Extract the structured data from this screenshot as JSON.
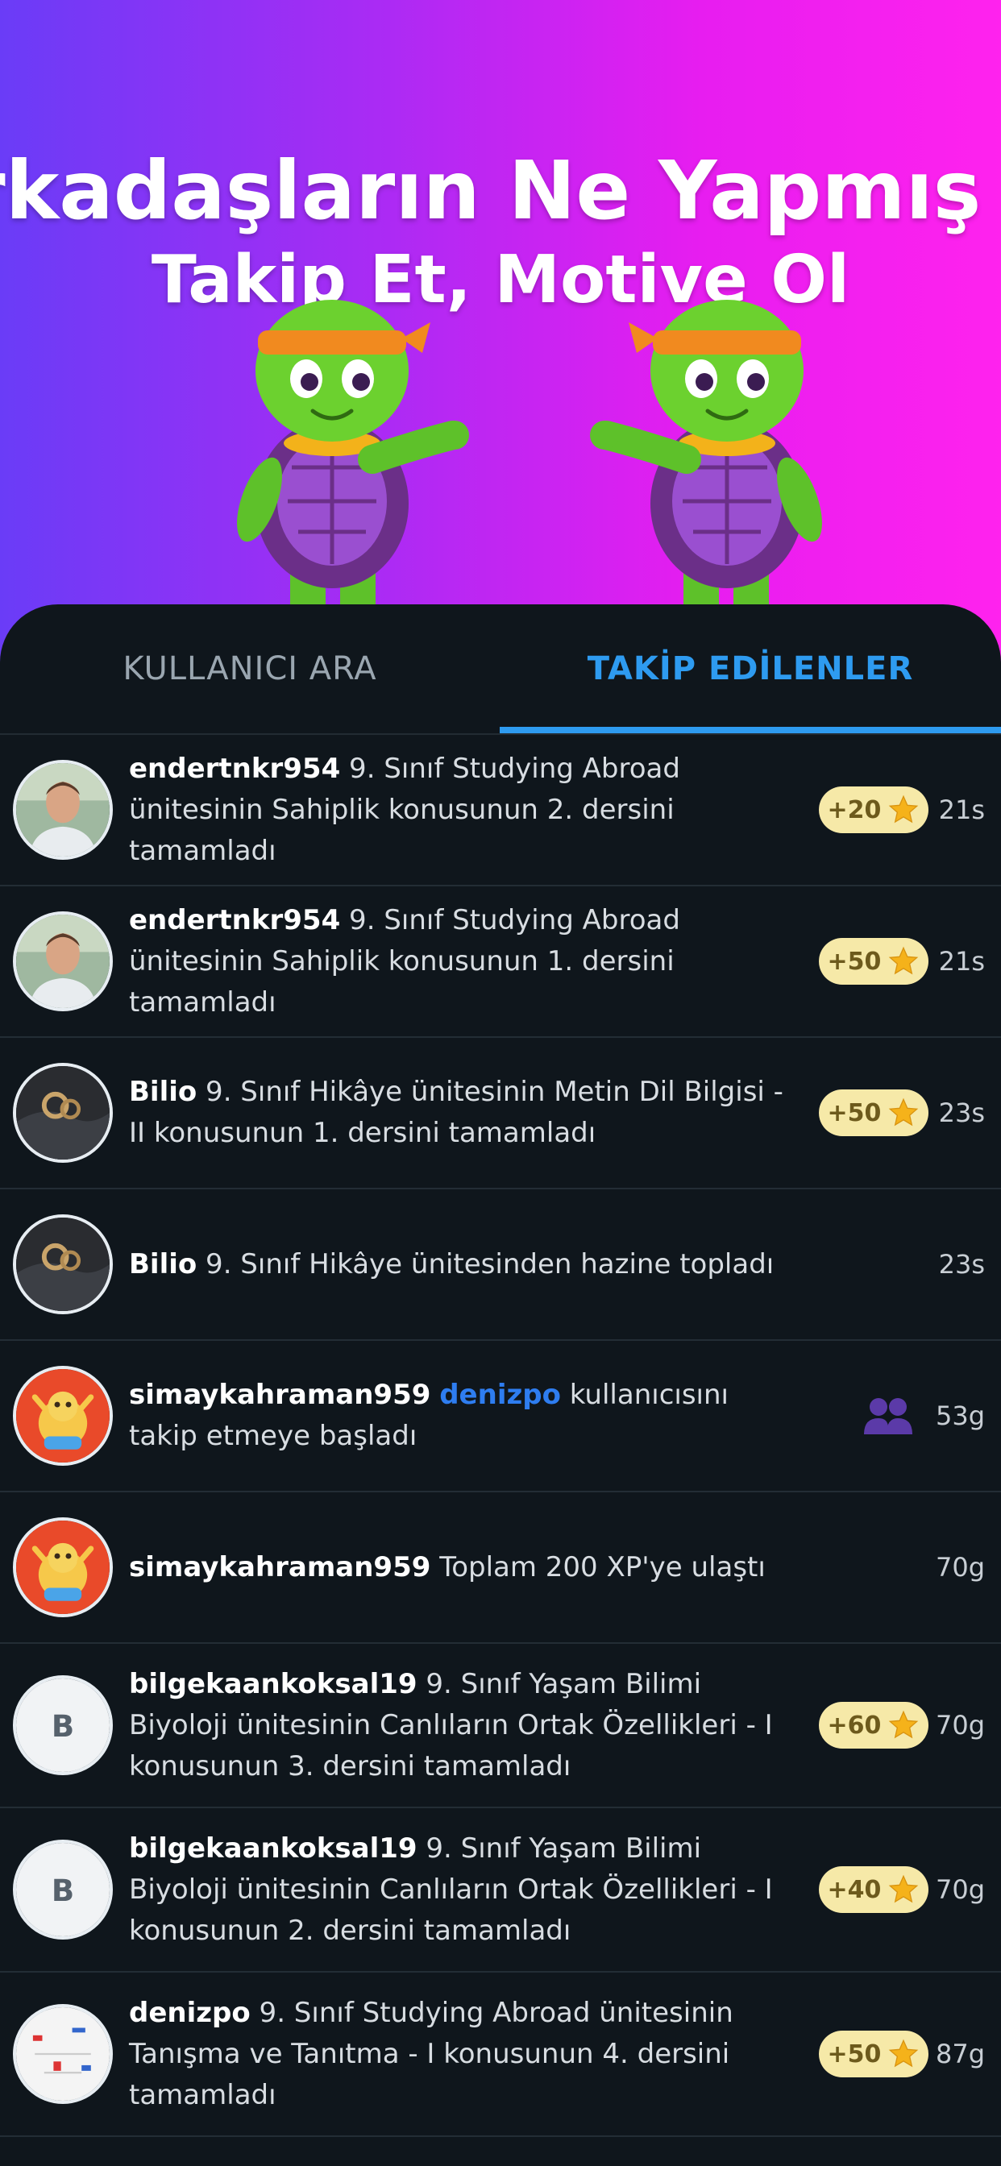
{
  "hero": {
    "headline_line1": "Arkadaşların Ne Yapmış Bak",
    "headline_line2": "Takip Et, Motive Ol"
  },
  "tabs": {
    "search_label": "KULLANICI ARA",
    "following_label": "TAKİP EDİLENLER",
    "active": "following"
  },
  "feed": [
    {
      "username": "endertnkr954",
      "text": " 9. Sınıf Studying Abroad ünitesinin Sahiplik konusunun 2. dersini tamamladı",
      "xp": "+20",
      "time": "21s",
      "avatar": "photo-man"
    },
    {
      "username": "endertnkr954",
      "text": " 9. Sınıf Studying Abroad ünitesinin Sahiplik konusunun 1. dersini tamamladı",
      "xp": "+50",
      "time": "21s",
      "avatar": "photo-man"
    },
    {
      "username": "Bilio",
      "text": " 9. Sınıf Hikâye ünitesinin Metin Dil Bilgisi - II konusunun 1. dersini tamamladı",
      "xp": "+50",
      "time": "23s",
      "avatar": "photo-dark"
    },
    {
      "username": "Bilio",
      "text": " 9. Sınıf Hikâye ünitesinden hazine topladı",
      "xp": "",
      "time": "23s",
      "avatar": "photo-dark"
    },
    {
      "username": "simaykahraman959",
      "mention": "denizpo",
      "text": " kullanıcısını takip etmeye başladı",
      "xp": "",
      "time": "53g",
      "avatar": "cartoon",
      "icon": "follow-users-icon"
    },
    {
      "username": "simaykahraman959",
      "text": " Toplam 200 XP'ye ulaştı",
      "xp": "",
      "time": "70g",
      "avatar": "cartoon"
    },
    {
      "username": "bilgekaankoksal19",
      "text": " 9. Sınıf Yaşam Bilimi Biyoloji ünitesinin Canlıların Ortak Özellikleri - I konusunun 3. dersini tamamladı",
      "xp": "+60",
      "time": "70g",
      "avatar": "letter",
      "avatar_letter": "B"
    },
    {
      "username": "bilgekaankoksal19",
      "text": " 9. Sınıf Yaşam Bilimi Biyoloji ünitesinin Canlıların Ortak Özellikleri - I konusunun 2. dersini tamamladı",
      "xp": "+40",
      "time": "70g",
      "avatar": "letter",
      "avatar_letter": "B"
    },
    {
      "username": "denizpo",
      "text": " 9. Sınıf Studying Abroad ünitesinin Tanışma ve Tanıtma - I konusunun 4. dersini tamamladı",
      "xp": "+50",
      "time": "87g",
      "avatar": "photo-sketch"
    }
  ],
  "colors": {
    "accent_blue": "#2e9bf0",
    "panel_bg": "#0f161c",
    "badge_bg": "#f6e9a8",
    "star": "#f5b21a",
    "mention": "#2e7df0",
    "follow_icon": "#5b3aa8"
  }
}
